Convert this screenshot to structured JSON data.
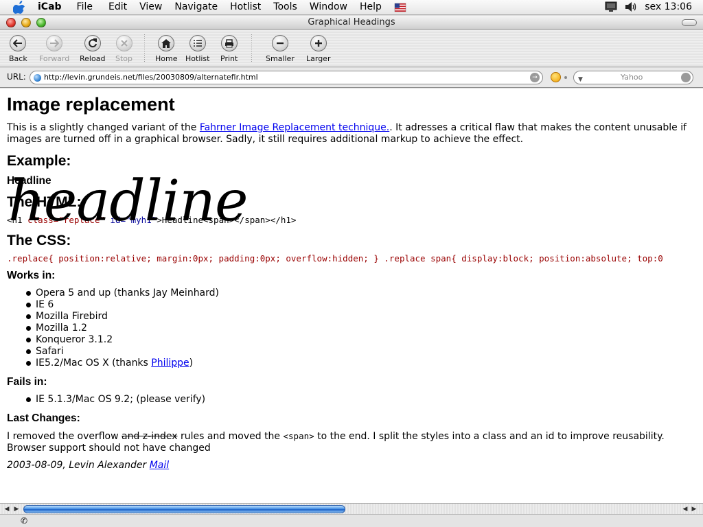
{
  "menubar": {
    "app_name": "iCab",
    "items": [
      "File",
      "Edit",
      "View",
      "Navigate",
      "Hotlist",
      "Tools",
      "Window",
      "Help"
    ],
    "clock": "sex 13:06",
    "icons": [
      "apple-icon",
      "flag-icon",
      "display-icon",
      "volume-icon"
    ]
  },
  "window": {
    "title": "Graphical Headings"
  },
  "toolbar": {
    "back": "Back",
    "forward": "Forward",
    "reload": "Reload",
    "stop": "Stop",
    "home": "Home",
    "hotlist": "Hotlist",
    "print": "Print",
    "smaller": "Smaller",
    "larger": "Larger"
  },
  "urlbar": {
    "label": "URL:",
    "url": "http://levin.grundeis.net/files/20030809/alternatefir.html",
    "search_placeholder": "Yahoo"
  },
  "page": {
    "title": "Image replacement",
    "intro_before": "This is a slightly changed variant of the ",
    "intro_link": "Fahrner Image Replacement technique.",
    "intro_after": ". It adresses a critical flaw that makes the content unusable if images are turned off in a graphical browser. Sadly, it still requires additional markup to achieve the effect.",
    "example_heading": "Example:",
    "example_text": "Headline",
    "example_image_text": "headline",
    "html_heading": "The HTML:",
    "html_code": {
      "open": "<h1 ",
      "attr1": "class=\"replace\"",
      "sp": " ",
      "attr2": "id=\"myh1\"",
      "rest": ">Headline<span></span></h1>"
    },
    "css_heading": "The CSS:",
    "css_code": ".replace{ position:relative; margin:0px; padding:0px; overflow:hidden; } .replace span{ display:block; position:absolute; top:0",
    "works_heading": "Works in:",
    "works_items": [
      "Opera 5 and up (thanks Jay Meinhard)",
      "IE 6",
      "Mozilla Firebird",
      "Mozilla 1.2",
      "Konqueror 3.1.2",
      "Safari"
    ],
    "works_last_before": "IE5.2/Mac OS X (thanks ",
    "works_last_link": "Philippe",
    "works_last_after": ")",
    "fails_heading": "Fails in:",
    "fails_items": [
      "IE 5.1.3/Mac OS 9.2; (please verify)"
    ],
    "changes_heading": "Last Changes:",
    "changes_a": "I removed the overflow ",
    "changes_strike": "and z-index",
    "changes_b": " rules and moved the ",
    "changes_span": "<span>",
    "changes_c": " to the end. I split the styles into a class and an id to improve reusability. Browser support should not have changed",
    "footer_text": "2003-08-09, Levin Alexander ",
    "footer_link": "Mail"
  },
  "scrollbar": {
    "position": 0.0
  }
}
